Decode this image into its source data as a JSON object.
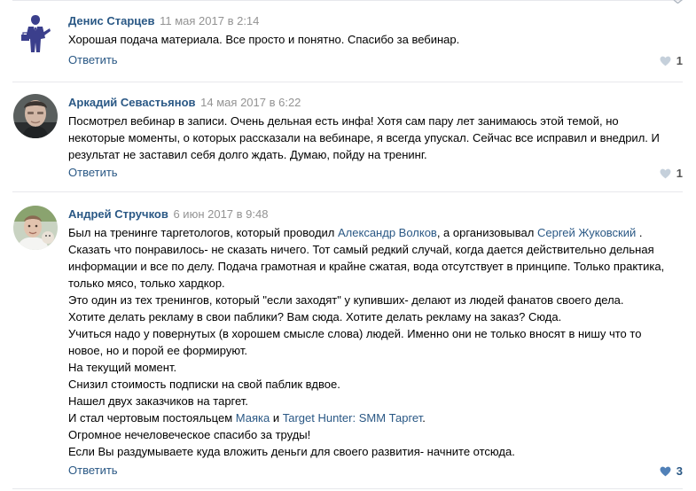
{
  "comments": [
    {
      "author": "Денис Старцев",
      "date": "11 мая 2017 в 2:14",
      "lines": [
        {
          "parts": [
            {
              "t": "Хорошая подача материала. Все просто и понятно. Спасибо за вебинар."
            }
          ]
        }
      ],
      "reply_label": "Ответить",
      "likes": "1"
    },
    {
      "author": "Аркадий Севастьянов",
      "date": "14 мая 2017 в 6:22",
      "lines": [
        {
          "parts": [
            {
              "t": "Посмотрел вебинар в записи. Очень дельная есть инфа! Хотя сам пару лет занимаюсь этой темой, но"
            }
          ]
        },
        {
          "parts": [
            {
              "t": "некоторые моменты, о которых рассказали на вебинаре, я всегда упускал. Сейчас все исправил и внедрил. И"
            }
          ]
        },
        {
          "parts": [
            {
              "t": "результат не заставил себя долго ждать. Думаю, пойду на тренинг."
            }
          ]
        }
      ],
      "reply_label": "Ответить",
      "likes": "1"
    },
    {
      "author": "Андрей Стручков",
      "date": "6 июн 2017 в 9:48",
      "lines": [
        {
          "parts": [
            {
              "t": "Был на тренинге таргетологов, который проводил "
            },
            {
              "t": "Александр Волков",
              "link": true
            },
            {
              "t": ", а организовывал "
            },
            {
              "t": "Сергей Жуковский",
              "link": true
            },
            {
              "t": " ."
            }
          ]
        },
        {
          "parts": [
            {
              "t": "Сказать что понравилось- не сказать ничего. Тот самый редкий случай, когда дается действительно дельная"
            }
          ]
        },
        {
          "parts": [
            {
              "t": "информации и все по делу. Подача грамотная и крайне сжатая, вода отсутствует в принципе. Только практика,"
            }
          ]
        },
        {
          "parts": [
            {
              "t": "только мясо, только хардкор."
            }
          ]
        },
        {
          "parts": [
            {
              "t": "Это один из тех тренингов, который \"если заходят\" у купивших- делают из людей фанатов своего дела."
            }
          ]
        },
        {
          "parts": [
            {
              "t": "Хотите делать рекламу в свои паблики? Вам сюда. Хотите делать рекламу на заказ? Сюда."
            }
          ]
        },
        {
          "parts": [
            {
              "t": "Учиться надо у повернутых (в хорошем смысле слова) людей. Именно они не только вносят в нишу что то"
            }
          ]
        },
        {
          "parts": [
            {
              "t": "новое, но и порой ее формируют."
            }
          ]
        },
        {
          "parts": [
            {
              "t": "На текущий момент."
            }
          ]
        },
        {
          "parts": [
            {
              "t": "Снизил стоимость подписки на свой паблик вдвое."
            }
          ]
        },
        {
          "parts": [
            {
              "t": "Нашел двух заказчиков на таргет."
            }
          ]
        },
        {
          "parts": [
            {
              "t": "И стал чертовым постояльцем "
            },
            {
              "t": "Маяка",
              "link": true
            },
            {
              "t": " и "
            },
            {
              "t": "Target Hunter: SMM Таргет",
              "link": true
            },
            {
              "t": "."
            }
          ]
        },
        {
          "parts": [
            {
              "t": "Огромное нечеловеческое спасибо за труды!"
            }
          ]
        },
        {
          "parts": [
            {
              "t": "Если Вы раздумываете куда вложить деньги для своего развития- начните отсюда."
            }
          ]
        }
      ],
      "reply_label": "Ответить",
      "likes": "3"
    }
  ],
  "colors": {
    "link": "#2a5885",
    "date": "#939393",
    "like_inactive": "#c5d0db",
    "like_active": "#5181b8"
  },
  "icons": {
    "like": "heart-icon"
  }
}
